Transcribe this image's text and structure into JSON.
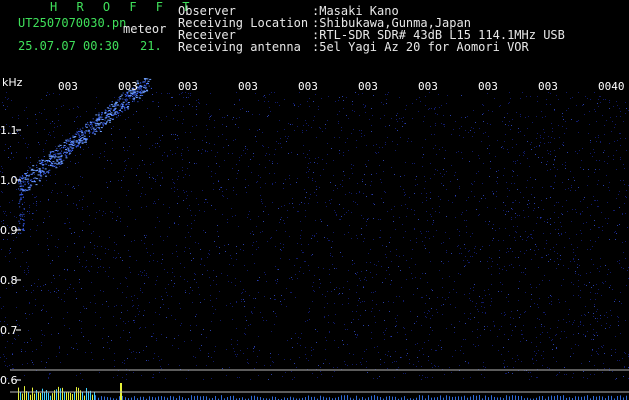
{
  "header": {
    "title": "H R O F F T",
    "filename": "UT2507070030.pn",
    "tag": "meteor",
    "datetime": "25.07.07 00:30",
    "frame": "21."
  },
  "info": [
    {
      "label": "Observer",
      "value": ":Masaki Kano"
    },
    {
      "label": "Receiving Location",
      "value": ":Shibukawa,Gunma,Japan"
    },
    {
      "label": "Receiver",
      "value": ":RTL-SDR SDR# 43dB L15 114.1MHz USB"
    },
    {
      "label": "Receiving antenna",
      "value": ":5el Yagi Az 20 for Aomori VOR"
    }
  ],
  "spectrogram": {
    "unit_label": "kHz",
    "y_ticks": [
      "1.1",
      "1.0",
      "0.9",
      "0.8",
      "0.7",
      "0.6"
    ],
    "y_range": [
      0.6,
      1.15
    ],
    "time_labels": [
      "003",
      "003",
      "003",
      "003",
      "003",
      "003",
      "003",
      "003",
      "003",
      "0040"
    ],
    "colors": {
      "background": "#000000",
      "signal": "#3a63ff",
      "noise": "#101a6a",
      "tick": "#ffffff",
      "base": "#e6f23a"
    }
  }
}
